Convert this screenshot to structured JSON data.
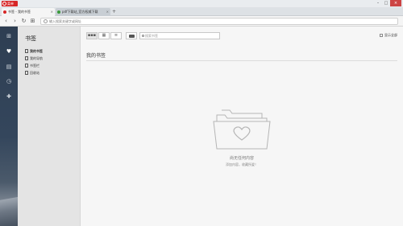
{
  "browser": {
    "menu_label": "菜单",
    "tabs": [
      {
        "title": "书签 - 我的书签",
        "active": true
      },
      {
        "title": "pdf下载站_官方权威下载",
        "active": false
      }
    ],
    "new_tab": "+",
    "address": {
      "placeholder": "输入搜索关键字或网址"
    },
    "window_controls": [
      "–",
      "□",
      "×"
    ]
  },
  "sidebar_icons": [
    "speed-dial-icon",
    "heart-icon",
    "news-icon",
    "history-icon",
    "extensions-icon"
  ],
  "bookmarks_nav": {
    "title": "书签",
    "items": [
      {
        "label": "我的书签",
        "active": true
      },
      {
        "label": "我的导航",
        "active": false
      },
      {
        "label": "书签栏",
        "active": false
      },
      {
        "label": "回收站",
        "active": false
      }
    ]
  },
  "toolbar": {
    "search_placeholder": "搜索书签",
    "show_all_label": "显示全部"
  },
  "main": {
    "section_title": "我的书签",
    "empty_title": "尚无任何内容",
    "empty_subtitle": "添加内容，收藏所爱！"
  },
  "colors": {
    "opera_red": "#d72626",
    "sidebar_dark": "#2e3e52",
    "panel_bg": "#e4e4e4",
    "main_bg": "#f6f6f6"
  }
}
